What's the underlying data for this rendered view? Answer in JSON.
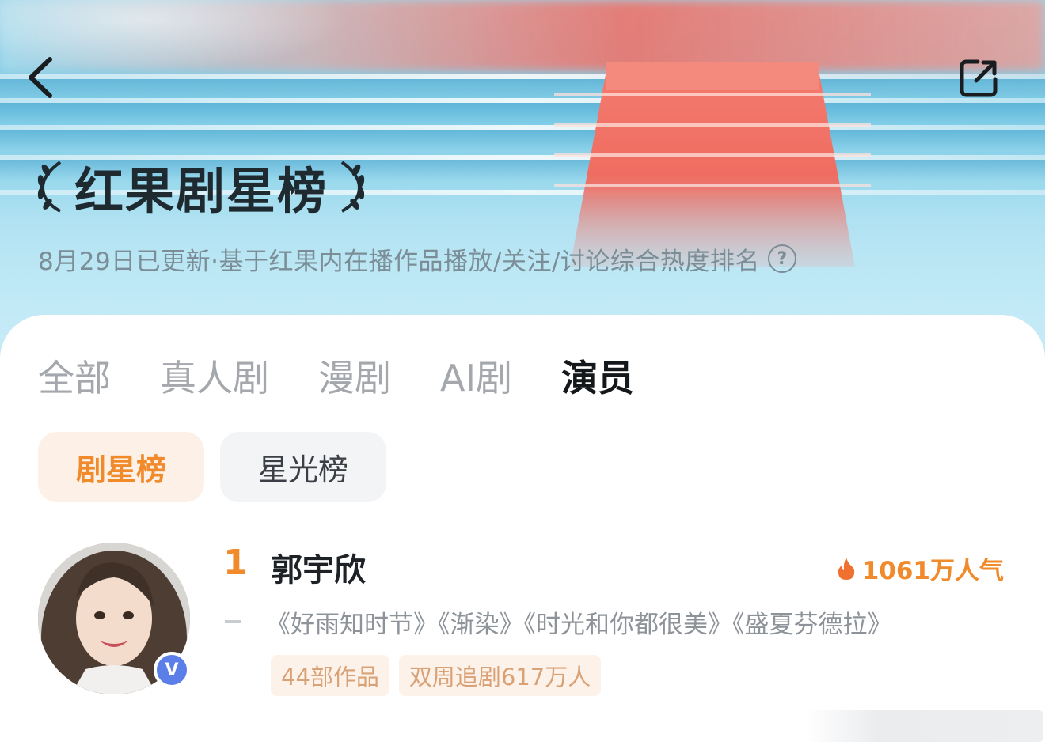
{
  "header": {
    "title": "红果剧星榜",
    "subtitle": "8月29日已更新·基于红果内在播作品播放/关注/讨论综合热度排名",
    "help_glyph": "?"
  },
  "icons": {
    "back": "chevron-left-icon",
    "share": "share-icon",
    "help": "question-circle-icon",
    "fire": "fire-icon",
    "verified": "verified-badge-icon"
  },
  "tabs": [
    {
      "label": "全部",
      "active": false
    },
    {
      "label": "真人剧",
      "active": false
    },
    {
      "label": "漫剧",
      "active": false
    },
    {
      "label": "AI剧",
      "active": false
    },
    {
      "label": "演员",
      "active": true
    }
  ],
  "subtabs": [
    {
      "label": "剧星榜",
      "active": true
    },
    {
      "label": "星光榜",
      "active": false
    }
  ],
  "ranking": [
    {
      "rank": "1",
      "name": "郭宇欣",
      "popularity": "1061万人气",
      "rank_change": "–",
      "verified_glyph": "V",
      "works": "《好雨知时节》《渐染》《时光和你都很美》《盛夏芬德拉》",
      "tags": [
        "44部作品",
        "双周追剧617万人"
      ]
    }
  ],
  "colors": {
    "accent": "#f08a2a",
    "title": "#1e2a30",
    "subtitle": "#7b8d96",
    "tab_inactive": "#a4a8ad",
    "tab_active": "#15181b",
    "tag_bg": "#fdf2ea",
    "tag_text": "#d9a276",
    "verified": "#5b7ee8"
  }
}
